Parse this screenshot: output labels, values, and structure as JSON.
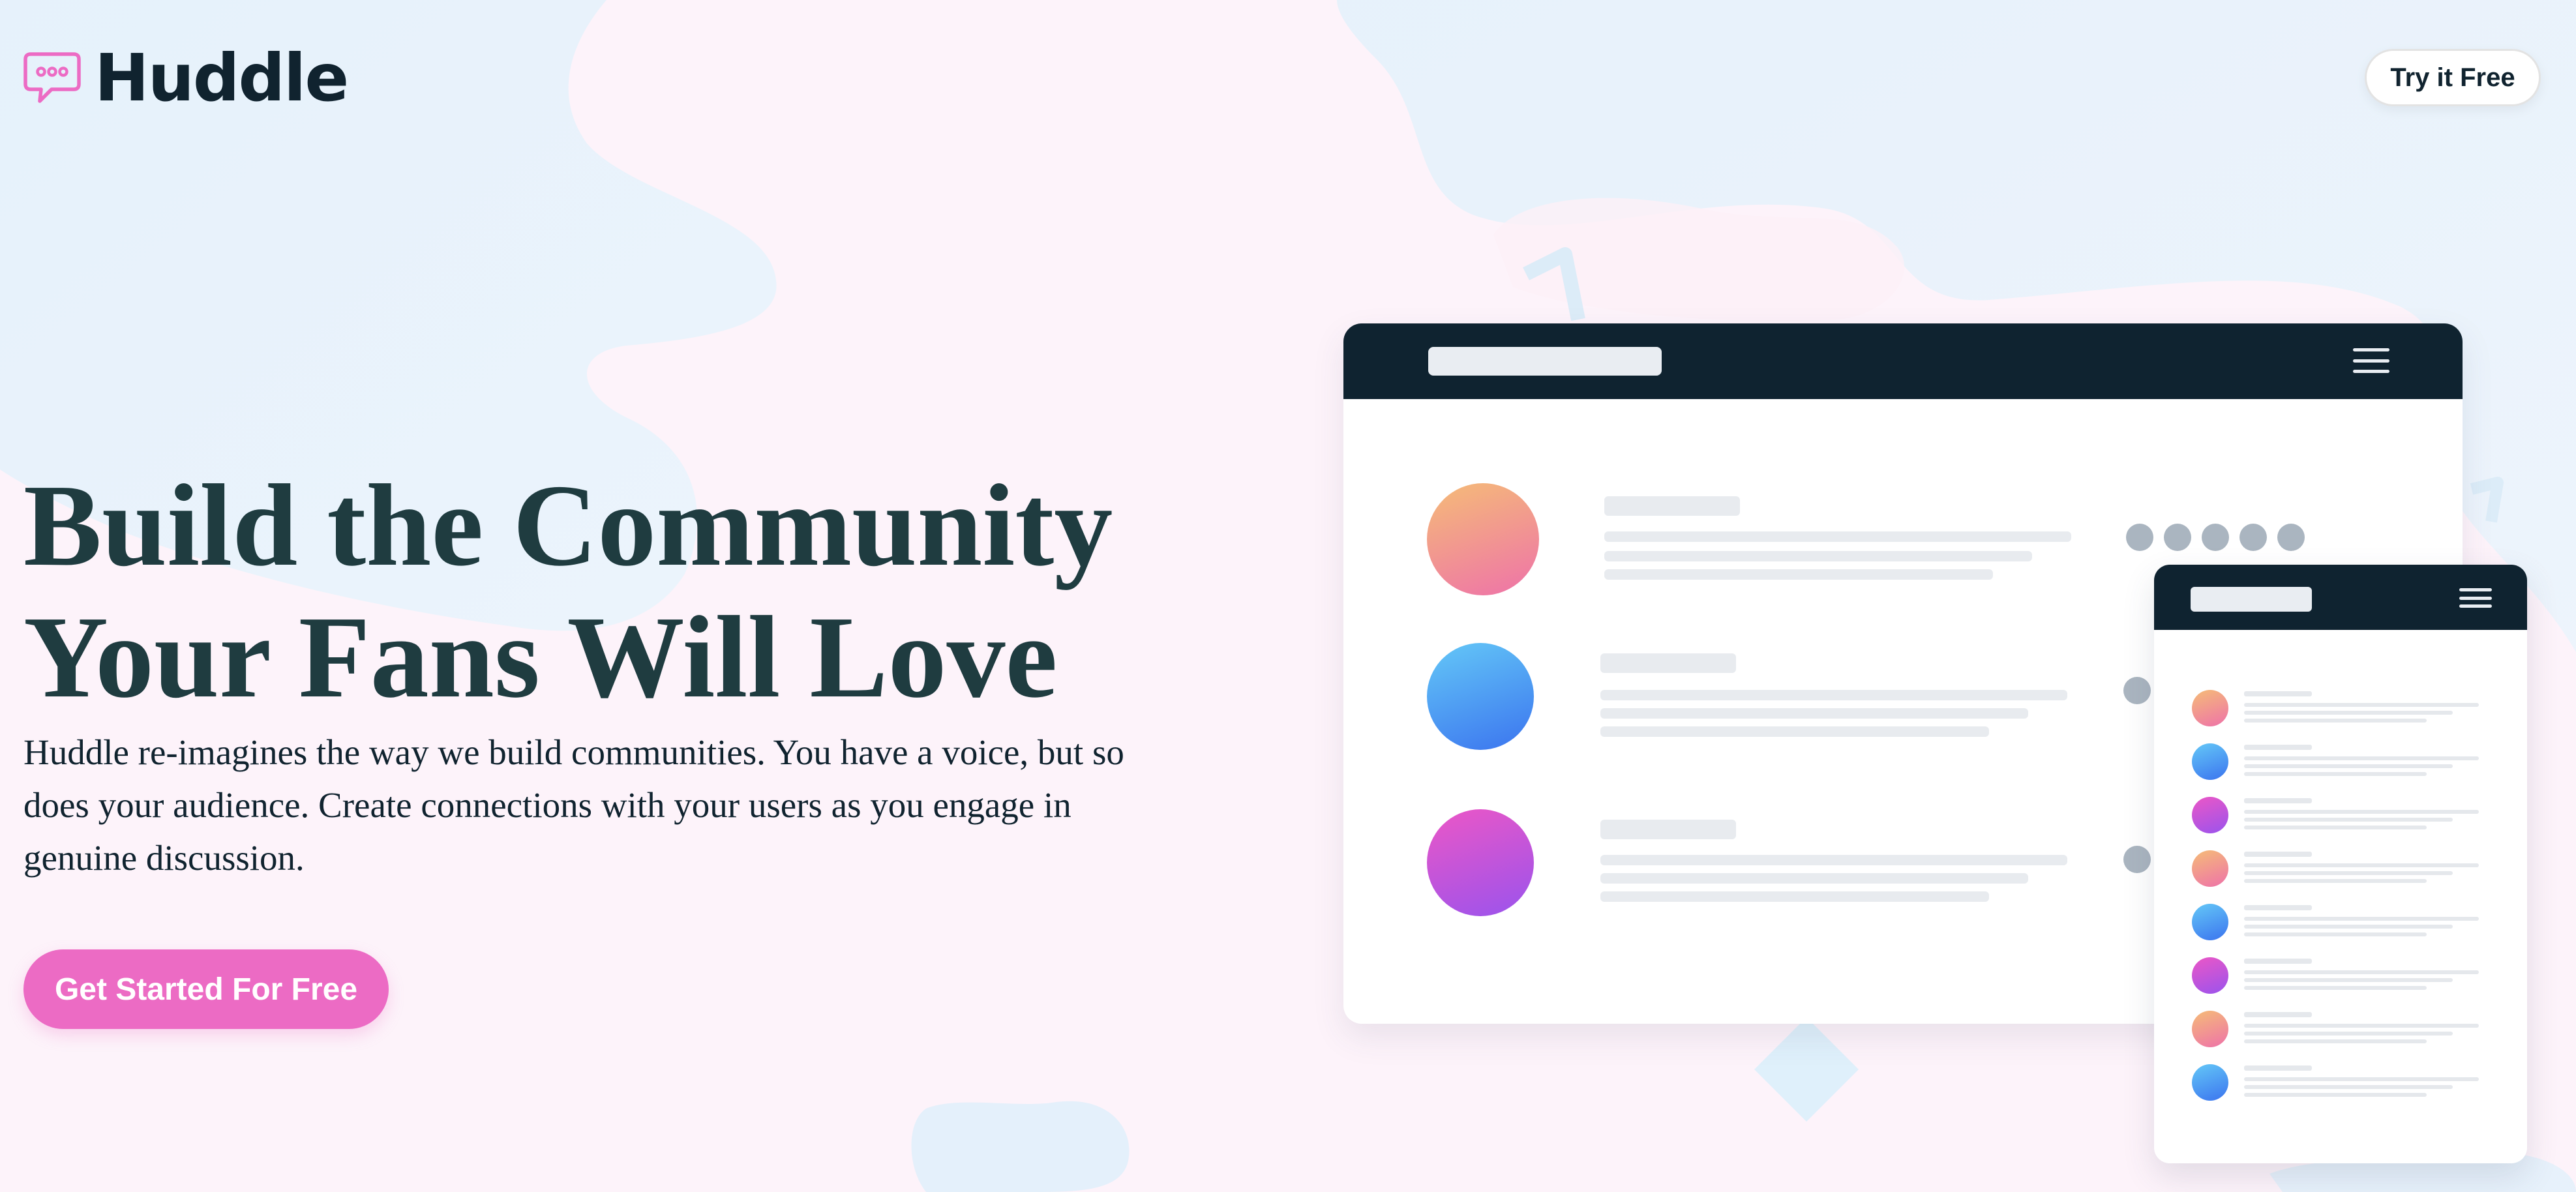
{
  "brand": {
    "name": "Huddle",
    "logo_icon": "chat-bubble-icon",
    "accent_color": "#ec6bc4",
    "text_color": "#1f3c40",
    "dark_color": "#0f2330"
  },
  "header": {
    "cta_label": "Try it Free"
  },
  "hero": {
    "headline_line1": "Build the Community",
    "headline_line2": "Your Fans Will Love",
    "description": "Huddle re-imagines the way we build communities. You have a voice, but so does your audience. Create connections with your users as you engage in genuine discussion.",
    "cta_label": "Get Started For Free"
  },
  "mockup": {
    "desktop_menu_icon": "hamburger-menu-icon",
    "phone_menu_icon": "hamburger-menu-icon",
    "desktop_rows": [
      {
        "avatar_gradient": [
          "#f5bc77",
          "#ee72a9"
        ]
      },
      {
        "avatar_gradient": [
          "#64c8f7",
          "#3b74ef"
        ]
      },
      {
        "avatar_gradient": [
          "#ec57c6",
          "#9a53ed"
        ]
      }
    ],
    "phone_rows": [
      {
        "avatar_gradient": [
          "#f5bc77",
          "#ee72a9"
        ]
      },
      {
        "avatar_gradient": [
          "#64c8f7",
          "#3b74ef"
        ]
      },
      {
        "avatar_gradient": [
          "#ec57c6",
          "#9a53ed"
        ]
      },
      {
        "avatar_gradient": [
          "#f5bc77",
          "#ee72a9"
        ]
      },
      {
        "avatar_gradient": [
          "#64c8f7",
          "#3b74ef"
        ]
      },
      {
        "avatar_gradient": [
          "#ec57c6",
          "#9a53ed"
        ]
      },
      {
        "avatar_gradient": [
          "#f5bc77",
          "#ee72a9"
        ]
      },
      {
        "avatar_gradient": [
          "#64c8f7",
          "#3b74ef"
        ]
      }
    ]
  }
}
